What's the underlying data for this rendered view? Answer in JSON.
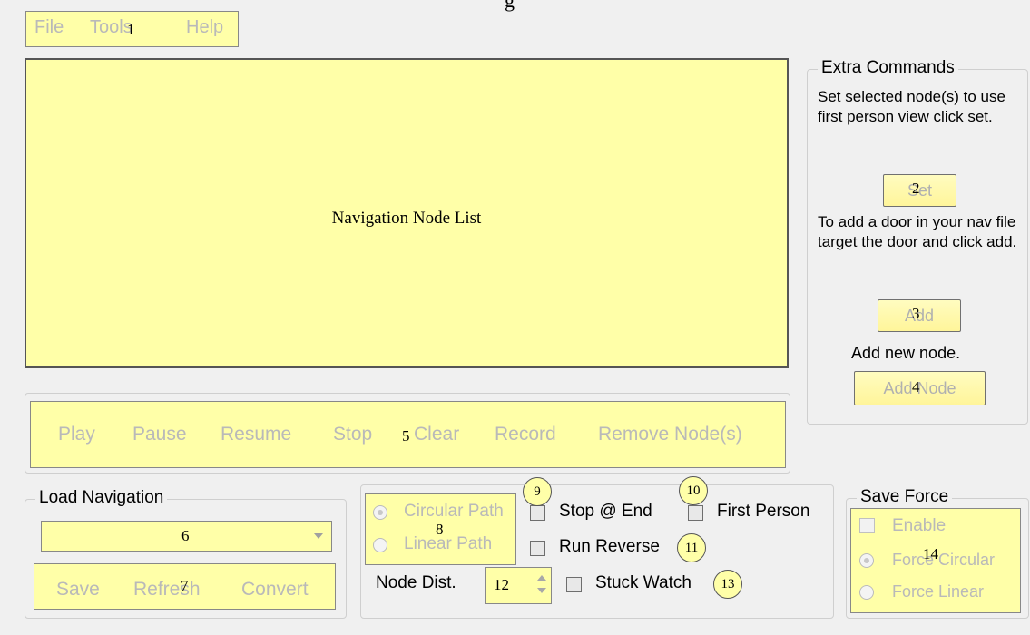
{
  "page_caption": "g",
  "menu": {
    "items": [
      "File",
      "Tools",
      "Help"
    ],
    "marker": "1"
  },
  "node_list": {
    "label": "Navigation Node List"
  },
  "extra_commands": {
    "title": "Extra Commands",
    "set_text": "Set selected node(s) to use first person view click set.",
    "set_button": "Set",
    "set_marker": "2",
    "door_text": "To add a door in your nav file target the door and click add.",
    "add_button": "Add",
    "add_marker": "3",
    "node_text": "Add new node.",
    "add_node_button": "Add Node",
    "add_node_marker": "4"
  },
  "playback": {
    "buttons": [
      "Play",
      "Pause",
      "Resume",
      "Stop",
      "Clear",
      "Record",
      "Remove Node(s)"
    ],
    "marker": "5"
  },
  "load_navigation": {
    "title": "Load Navigation",
    "dropdown_marker": "6",
    "buttons": [
      "Save",
      "Refresh",
      "Convert"
    ],
    "buttons_marker": "7"
  },
  "options": {
    "path_radios": [
      "Circular Path",
      "Linear Path"
    ],
    "path_marker": "8",
    "stop_at_end": "Stop @ End",
    "stop_marker": "9",
    "first_person": "First Person",
    "first_person_marker": "10",
    "run_reverse": "Run Reverse",
    "run_reverse_marker": "11",
    "node_dist_label": "Node Dist.",
    "node_dist_marker": "12",
    "stuck_watch": "Stuck Watch",
    "stuck_marker": "13"
  },
  "save_force": {
    "title": "Save Force",
    "enable": "Enable",
    "radios": [
      "Force Circular",
      "Force Linear"
    ],
    "marker": "14"
  }
}
